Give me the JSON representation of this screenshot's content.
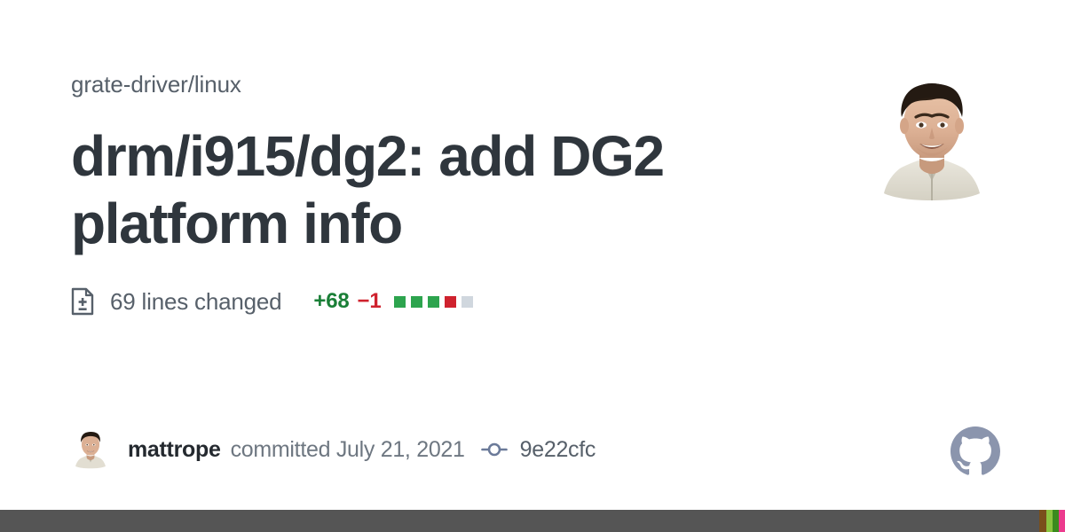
{
  "card": {
    "repo": "grate-driver/linux",
    "title": "drm/i915/dg2: add DG2 platform info",
    "background_color": "#ffffff"
  },
  "stats": {
    "diff_icon_name": "diff-file-icon",
    "lines_changed": "69 lines changed",
    "additions": "+68",
    "deletions": "−1",
    "additions_color": "#1a7f37",
    "deletions_color": "#cf222e",
    "diff_blocks": [
      {
        "name": "diff-block-addition",
        "color": "#2da44e"
      },
      {
        "name": "diff-block-addition",
        "color": "#2da44e"
      },
      {
        "name": "diff-block-addition",
        "color": "#2da44e"
      },
      {
        "name": "diff-block-deletion",
        "color": "#cf222e"
      },
      {
        "name": "diff-block-neutral",
        "color": "#d0d7de"
      }
    ]
  },
  "footer": {
    "author": "mattrope",
    "committed_text": "committed July 21, 2021",
    "commit_icon_name": "git-commit-icon",
    "commit_hash": "9e22cfc",
    "logo_name": "github-octocat-logo",
    "logo_color": "#8b95ad",
    "avatar_alt": "mattrope"
  },
  "bottom_bar": {
    "color": "#555555",
    "stripes": [
      {
        "name": "bar-stripe-brown",
        "color": "#7a4f1b",
        "width": 8
      },
      {
        "name": "bar-stripe-light-green",
        "color": "#8bc53f",
        "width": 7
      },
      {
        "name": "bar-stripe-dark-green",
        "color": "#3a8b1e",
        "width": 7
      },
      {
        "name": "bar-stripe-magenta",
        "color": "#ec3b8e",
        "width": 7
      }
    ]
  }
}
